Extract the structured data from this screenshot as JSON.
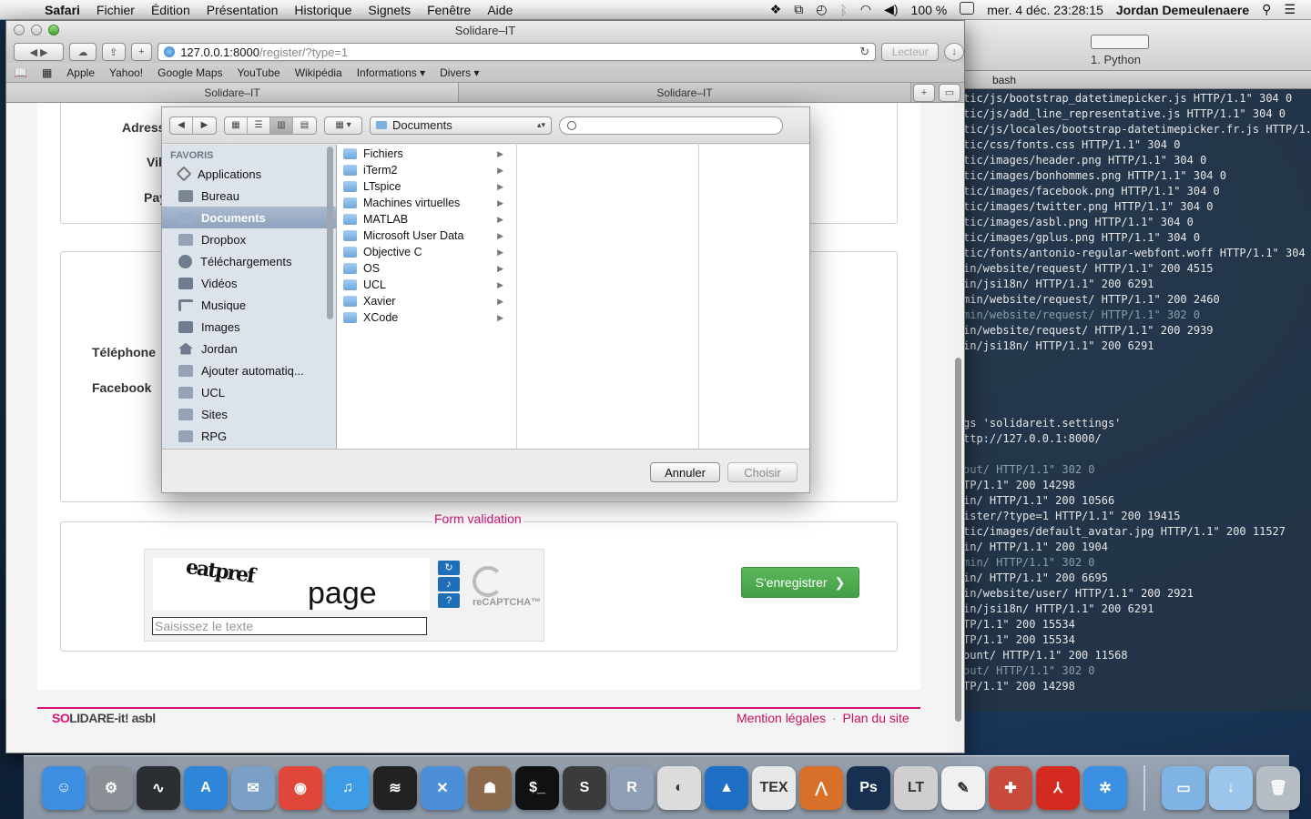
{
  "menubar": {
    "app_name": "Safari",
    "items": [
      "Fichier",
      "Édition",
      "Présentation",
      "Historique",
      "Signets",
      "Fenêtre",
      "Aide"
    ],
    "battery": "100 %",
    "datetime": "mer. 4 déc.  23:28:15",
    "user": "Jordan Demeulenaere"
  },
  "safari": {
    "window_title": "Solidare–IT",
    "url_host": "127.0.0.1:8000",
    "url_path": "/register/?type=1",
    "reader_label": "Lecteur",
    "bookmarks": [
      "Apple",
      "Yahoo!",
      "Google Maps",
      "YouTube",
      "Wikipédia",
      "Informations ▾",
      "Divers ▾"
    ],
    "tabs": [
      "Solidare–IT",
      "Solidare–IT"
    ]
  },
  "page": {
    "labels": {
      "address": "Adress",
      "city": "Vil",
      "country": "Pay",
      "phone": "Téléphone",
      "facebook": "Facebook"
    },
    "form_validation_legend": "Form validation",
    "captcha": {
      "word1": "eatpref",
      "word2": "page",
      "input_placeholder": "Saisissez le texte",
      "brand": "reCAPTCHA™"
    },
    "register_button": "S'enregistrer",
    "footer": {
      "logo_prefix": "SO",
      "logo_rest": "LIDARE-it! asbl",
      "link_legal": "Mention légales",
      "separator": "·",
      "link_sitemap": "Plan du site"
    }
  },
  "dialog": {
    "location": "Documents",
    "sidebar_header": "FAVORIS",
    "sidebar_items": [
      {
        "label": "Applications",
        "icon": "applications-icon"
      },
      {
        "label": "Bureau",
        "icon": "desktop-icon"
      },
      {
        "label": "Documents",
        "icon": "documents-icon",
        "selected": true
      },
      {
        "label": "Dropbox",
        "icon": "folder-icon"
      },
      {
        "label": "Téléchargements",
        "icon": "downloads-icon"
      },
      {
        "label": "Vidéos",
        "icon": "movies-icon"
      },
      {
        "label": "Musique",
        "icon": "music-icon"
      },
      {
        "label": "Images",
        "icon": "pictures-icon"
      },
      {
        "label": "Jordan",
        "icon": "home-icon"
      },
      {
        "label": "Ajouter automatiq...",
        "icon": "folder-icon"
      },
      {
        "label": "UCL",
        "icon": "folder-icon"
      },
      {
        "label": "Sites",
        "icon": "folder-icon"
      },
      {
        "label": "RPG",
        "icon": "folder-icon"
      }
    ],
    "folders": [
      "Fichiers",
      "iTerm2",
      "LTspice",
      "Machines virtuelles",
      "MATLAB",
      "Microsoft User Data",
      "Objective C",
      "OS",
      "UCL",
      "Xavier",
      "XCode"
    ],
    "cancel_label": "Annuler",
    "choose_label": "Choisir"
  },
  "terminal": {
    "window_title": "1. Python",
    "tab_label": "bash",
    "lines": [
      {
        "t": "tic/js/bootstrap_datetimepicker.js HTTP/1.1\" 304 0",
        "dim": false
      },
      {
        "t": "tic/js/add_line_representative.js HTTP/1.1\" 304 0",
        "dim": false
      },
      {
        "t": "tic/js/locales/bootstrap-datetimepicker.fr.js HTTP/1.1\"",
        "dim": false
      },
      {
        "t": "tic/css/fonts.css HTTP/1.1\" 304 0",
        "dim": false
      },
      {
        "t": "tic/images/header.png HTTP/1.1\" 304 0",
        "dim": false
      },
      {
        "t": "tic/images/bonhommes.png HTTP/1.1\" 304 0",
        "dim": false
      },
      {
        "t": "tic/images/facebook.png HTTP/1.1\" 304 0",
        "dim": false
      },
      {
        "t": "tic/images/twitter.png HTTP/1.1\" 304 0",
        "dim": false
      },
      {
        "t": "tic/images/asbl.png HTTP/1.1\" 304 0",
        "dim": false
      },
      {
        "t": "tic/images/gplus.png HTTP/1.1\" 304 0",
        "dim": false
      },
      {
        "t": "tic/fonts/antonio-regular-webfont.woff HTTP/1.1\" 304 0",
        "dim": false
      },
      {
        "t": "in/website/request/ HTTP/1.1\" 200 4515",
        "dim": false
      },
      {
        "t": "in/jsi18n/ HTTP/1.1\" 200 6291",
        "dim": false
      },
      {
        "t": "min/website/request/ HTTP/1.1\" 200 2460",
        "dim": false
      },
      {
        "t": "min/website/request/ HTTP/1.1\" 302 0",
        "dim": true
      },
      {
        "t": "in/website/request/ HTTP/1.1\" 200 2939",
        "dim": false
      },
      {
        "t": "in/jsi18n/ HTTP/1.1\" 200 6291",
        "dim": false
      },
      {
        "t": "",
        "dim": false
      },
      {
        "t": "",
        "dim": false
      },
      {
        "t": "",
        "dim": false
      },
      {
        "t": "",
        "dim": false
      },
      {
        "t": "gs 'solidareit.settings'",
        "dim": false
      },
      {
        "t": "ttp://127.0.0.1:8000/",
        "dim": false
      },
      {
        "t": "",
        "dim": false
      },
      {
        "t": "out/ HTTP/1.1\" 302 0",
        "dim": true
      },
      {
        "t": "TP/1.1\" 200 14298",
        "dim": false
      },
      {
        "t": "in/ HTTP/1.1\" 200 10566",
        "dim": false
      },
      {
        "t": "ister/?type=1 HTTP/1.1\" 200 19415",
        "dim": false
      },
      {
        "t": "tic/images/default_avatar.jpg HTTP/1.1\" 200 11527",
        "dim": false
      },
      {
        "t": "in/ HTTP/1.1\" 200 1904",
        "dim": false
      },
      {
        "t": "min/ HTTP/1.1\" 302 0",
        "dim": true
      },
      {
        "t": "in/ HTTP/1.1\" 200 6695",
        "dim": false
      },
      {
        "t": "in/website/user/ HTTP/1.1\" 200 2921",
        "dim": false
      },
      {
        "t": "in/jsi18n/ HTTP/1.1\" 200 6291",
        "dim": false
      },
      {
        "t": "TP/1.1\" 200 15534",
        "dim": false
      },
      {
        "t": "TP/1.1\" 200 15534",
        "dim": false
      },
      {
        "t": "ount/ HTTP/1.1\" 200 11568",
        "dim": false
      },
      {
        "t": "out/ HTTP/1.1\" 302 0",
        "dim": true
      },
      {
        "t": "TP/1.1\" 200 14298",
        "dim": false
      }
    ]
  },
  "dock": [
    {
      "name": "finder-icon",
      "color": "#3d8ee0",
      "glyph": "☺"
    },
    {
      "name": "system-preferences-icon",
      "color": "#8a8f96",
      "glyph": "⚙"
    },
    {
      "name": "activity-monitor-icon",
      "color": "#2b2f33",
      "glyph": "∿"
    },
    {
      "name": "app-store-icon",
      "color": "#2f86d8",
      "glyph": "A"
    },
    {
      "name": "preview-icon",
      "color": "#7ba0c8",
      "glyph": "✉"
    },
    {
      "name": "chrome-icon",
      "color": "#e0463a",
      "glyph": "◉"
    },
    {
      "name": "itunes-icon",
      "color": "#3e9be6",
      "glyph": "♫"
    },
    {
      "name": "spotify-icon",
      "color": "#222222",
      "glyph": "≋"
    },
    {
      "name": "xcode-icon",
      "color": "#4d8fd6",
      "glyph": "✕"
    },
    {
      "name": "github-icon",
      "color": "#8a6a4a",
      "glyph": "☗"
    },
    {
      "name": "terminal-icon",
      "color": "#111111",
      "glyph": "$_"
    },
    {
      "name": "sublime-text-icon",
      "color": "#3b3b3b",
      "glyph": "S"
    },
    {
      "name": "r-icon",
      "color": "#8fa0b6",
      "glyph": "R"
    },
    {
      "name": "ltspice-icon",
      "color": "#dcdcdc",
      "glyph": "◐"
    },
    {
      "name": "wireshark-icon",
      "color": "#1f6fc4",
      "glyph": "▲"
    },
    {
      "name": "tex-icon",
      "color": "#e8e8e8",
      "glyph": "TEX"
    },
    {
      "name": "matlab-icon",
      "color": "#d8702a",
      "glyph": "⋀"
    },
    {
      "name": "photoshop-icon",
      "color": "#17304f",
      "glyph": "Ps"
    },
    {
      "name": "linear-technology-icon",
      "color": "#cfcfcf",
      "glyph": "LT"
    },
    {
      "name": "textedit-icon",
      "color": "#f0f0f0",
      "glyph": "✎"
    },
    {
      "name": "utility-icon",
      "color": "#c84a3a",
      "glyph": "✚"
    },
    {
      "name": "acrobat-icon",
      "color": "#d42a1f",
      "glyph": "⅄"
    },
    {
      "name": "safari-icon",
      "color": "#3a8fe0",
      "glyph": "✲"
    },
    {
      "name": "applications-folder-icon",
      "color": "#7fb3e3",
      "glyph": "▭"
    },
    {
      "name": "downloads-folder-icon",
      "color": "#9dc4ea",
      "glyph": "↓"
    },
    {
      "name": "trash-icon",
      "color": "#b5bcc4",
      "glyph": "🗑"
    }
  ]
}
